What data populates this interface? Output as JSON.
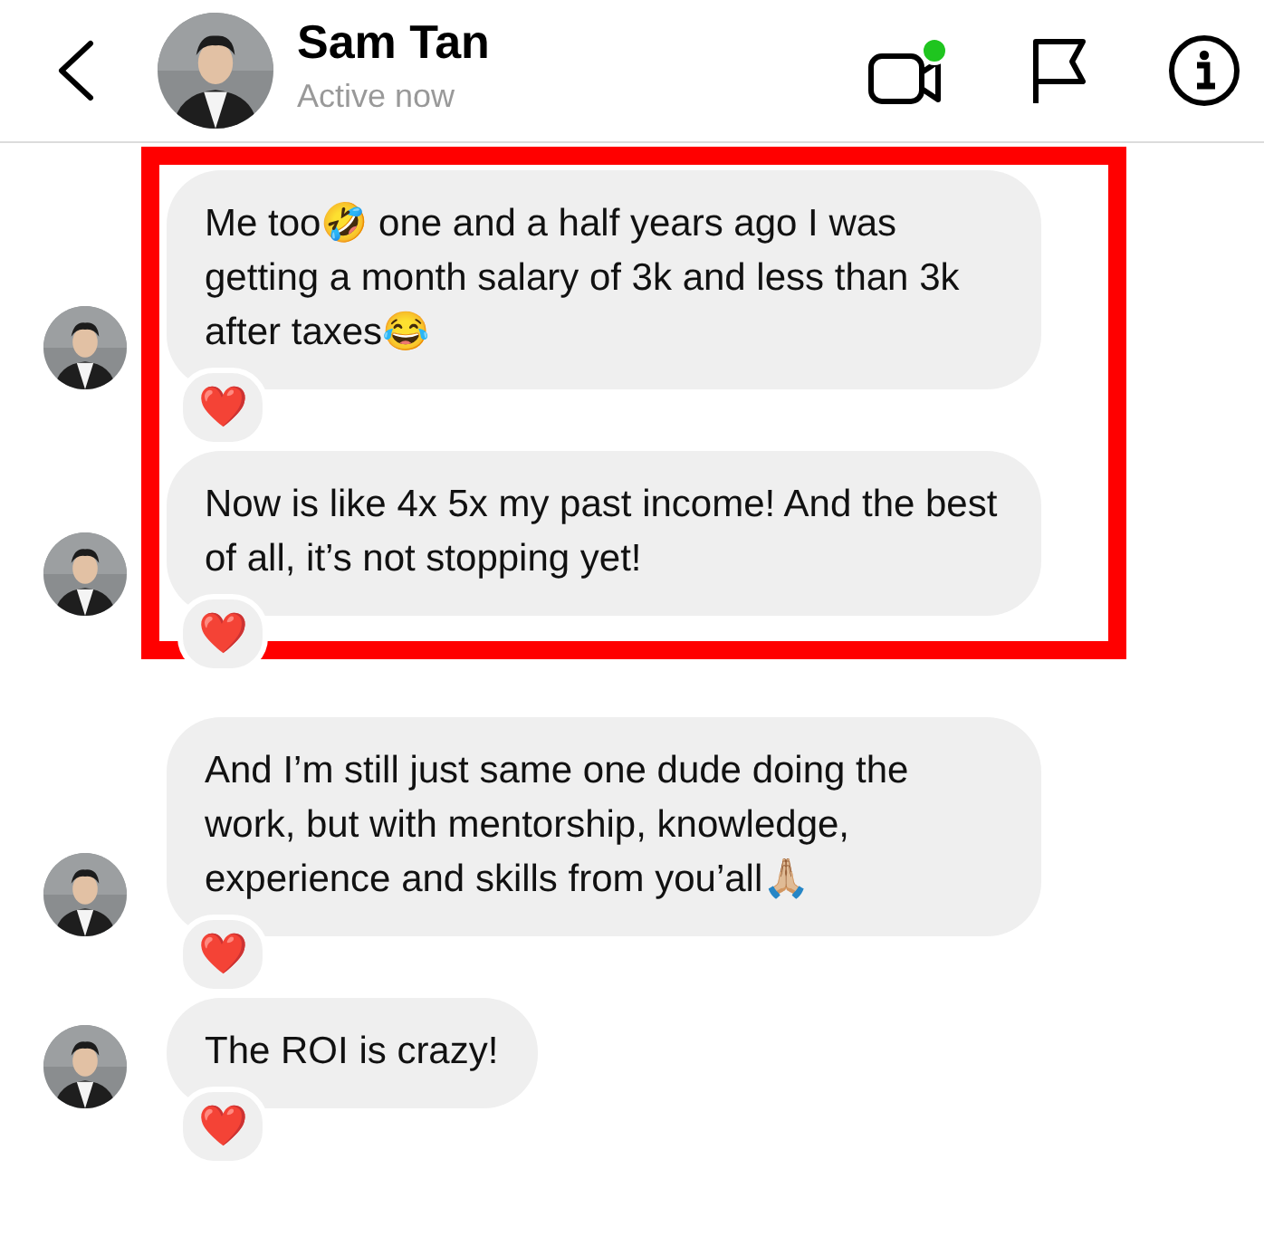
{
  "header": {
    "name": "Sam Tan",
    "status": "Active now",
    "video_online": true
  },
  "messages": [
    {
      "text": "Me too🤣 one and a half years ago I was getting a month salary of 3k and less than 3k after taxes😂",
      "reaction": "❤️",
      "highlighted": true
    },
    {
      "text": "Now is like 4x 5x my past income! And the best of all, it’s not stopping yet!",
      "reaction": "❤️",
      "highlighted": true
    },
    {
      "text": "And I’m still just same one dude doing the work, but with mentorship, knowledge, experience and skills from you’all🙏🏼",
      "reaction": "❤️",
      "highlighted": false
    },
    {
      "text": "The ROI is crazy!",
      "reaction": "❤️",
      "highlighted": false
    }
  ]
}
